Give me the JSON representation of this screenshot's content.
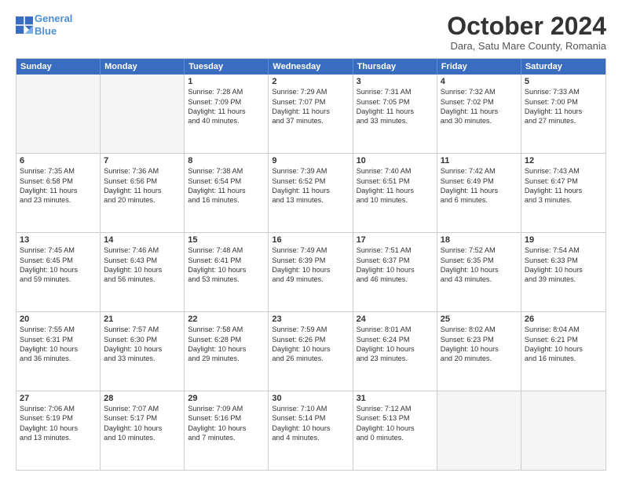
{
  "logo": {
    "line1": "General",
    "line2": "Blue"
  },
  "title": "October 2024",
  "subtitle": "Dara, Satu Mare County, Romania",
  "header_days": [
    "Sunday",
    "Monday",
    "Tuesday",
    "Wednesday",
    "Thursday",
    "Friday",
    "Saturday"
  ],
  "rows": [
    [
      {
        "day": "",
        "empty": true
      },
      {
        "day": "",
        "empty": true
      },
      {
        "day": "1",
        "lines": [
          "Sunrise: 7:28 AM",
          "Sunset: 7:09 PM",
          "Daylight: 11 hours",
          "and 40 minutes."
        ]
      },
      {
        "day": "2",
        "lines": [
          "Sunrise: 7:29 AM",
          "Sunset: 7:07 PM",
          "Daylight: 11 hours",
          "and 37 minutes."
        ]
      },
      {
        "day": "3",
        "lines": [
          "Sunrise: 7:31 AM",
          "Sunset: 7:05 PM",
          "Daylight: 11 hours",
          "and 33 minutes."
        ]
      },
      {
        "day": "4",
        "lines": [
          "Sunrise: 7:32 AM",
          "Sunset: 7:02 PM",
          "Daylight: 11 hours",
          "and 30 minutes."
        ]
      },
      {
        "day": "5",
        "lines": [
          "Sunrise: 7:33 AM",
          "Sunset: 7:00 PM",
          "Daylight: 11 hours",
          "and 27 minutes."
        ]
      }
    ],
    [
      {
        "day": "6",
        "lines": [
          "Sunrise: 7:35 AM",
          "Sunset: 6:58 PM",
          "Daylight: 11 hours",
          "and 23 minutes."
        ]
      },
      {
        "day": "7",
        "lines": [
          "Sunrise: 7:36 AM",
          "Sunset: 6:56 PM",
          "Daylight: 11 hours",
          "and 20 minutes."
        ]
      },
      {
        "day": "8",
        "lines": [
          "Sunrise: 7:38 AM",
          "Sunset: 6:54 PM",
          "Daylight: 11 hours",
          "and 16 minutes."
        ]
      },
      {
        "day": "9",
        "lines": [
          "Sunrise: 7:39 AM",
          "Sunset: 6:52 PM",
          "Daylight: 11 hours",
          "and 13 minutes."
        ]
      },
      {
        "day": "10",
        "lines": [
          "Sunrise: 7:40 AM",
          "Sunset: 6:51 PM",
          "Daylight: 11 hours",
          "and 10 minutes."
        ]
      },
      {
        "day": "11",
        "lines": [
          "Sunrise: 7:42 AM",
          "Sunset: 6:49 PM",
          "Daylight: 11 hours",
          "and 6 minutes."
        ]
      },
      {
        "day": "12",
        "lines": [
          "Sunrise: 7:43 AM",
          "Sunset: 6:47 PM",
          "Daylight: 11 hours",
          "and 3 minutes."
        ]
      }
    ],
    [
      {
        "day": "13",
        "lines": [
          "Sunrise: 7:45 AM",
          "Sunset: 6:45 PM",
          "Daylight: 10 hours",
          "and 59 minutes."
        ]
      },
      {
        "day": "14",
        "lines": [
          "Sunrise: 7:46 AM",
          "Sunset: 6:43 PM",
          "Daylight: 10 hours",
          "and 56 minutes."
        ]
      },
      {
        "day": "15",
        "lines": [
          "Sunrise: 7:48 AM",
          "Sunset: 6:41 PM",
          "Daylight: 10 hours",
          "and 53 minutes."
        ]
      },
      {
        "day": "16",
        "lines": [
          "Sunrise: 7:49 AM",
          "Sunset: 6:39 PM",
          "Daylight: 10 hours",
          "and 49 minutes."
        ]
      },
      {
        "day": "17",
        "lines": [
          "Sunrise: 7:51 AM",
          "Sunset: 6:37 PM",
          "Daylight: 10 hours",
          "and 46 minutes."
        ]
      },
      {
        "day": "18",
        "lines": [
          "Sunrise: 7:52 AM",
          "Sunset: 6:35 PM",
          "Daylight: 10 hours",
          "and 43 minutes."
        ]
      },
      {
        "day": "19",
        "lines": [
          "Sunrise: 7:54 AM",
          "Sunset: 6:33 PM",
          "Daylight: 10 hours",
          "and 39 minutes."
        ]
      }
    ],
    [
      {
        "day": "20",
        "lines": [
          "Sunrise: 7:55 AM",
          "Sunset: 6:31 PM",
          "Daylight: 10 hours",
          "and 36 minutes."
        ]
      },
      {
        "day": "21",
        "lines": [
          "Sunrise: 7:57 AM",
          "Sunset: 6:30 PM",
          "Daylight: 10 hours",
          "and 33 minutes."
        ]
      },
      {
        "day": "22",
        "lines": [
          "Sunrise: 7:58 AM",
          "Sunset: 6:28 PM",
          "Daylight: 10 hours",
          "and 29 minutes."
        ]
      },
      {
        "day": "23",
        "lines": [
          "Sunrise: 7:59 AM",
          "Sunset: 6:26 PM",
          "Daylight: 10 hours",
          "and 26 minutes."
        ]
      },
      {
        "day": "24",
        "lines": [
          "Sunrise: 8:01 AM",
          "Sunset: 6:24 PM",
          "Daylight: 10 hours",
          "and 23 minutes."
        ]
      },
      {
        "day": "25",
        "lines": [
          "Sunrise: 8:02 AM",
          "Sunset: 6:23 PM",
          "Daylight: 10 hours",
          "and 20 minutes."
        ]
      },
      {
        "day": "26",
        "lines": [
          "Sunrise: 8:04 AM",
          "Sunset: 6:21 PM",
          "Daylight: 10 hours",
          "and 16 minutes."
        ]
      }
    ],
    [
      {
        "day": "27",
        "lines": [
          "Sunrise: 7:06 AM",
          "Sunset: 5:19 PM",
          "Daylight: 10 hours",
          "and 13 minutes."
        ]
      },
      {
        "day": "28",
        "lines": [
          "Sunrise: 7:07 AM",
          "Sunset: 5:17 PM",
          "Daylight: 10 hours",
          "and 10 minutes."
        ]
      },
      {
        "day": "29",
        "lines": [
          "Sunrise: 7:09 AM",
          "Sunset: 5:16 PM",
          "Daylight: 10 hours",
          "and 7 minutes."
        ]
      },
      {
        "day": "30",
        "lines": [
          "Sunrise: 7:10 AM",
          "Sunset: 5:14 PM",
          "Daylight: 10 hours",
          "and 4 minutes."
        ]
      },
      {
        "day": "31",
        "lines": [
          "Sunrise: 7:12 AM",
          "Sunset: 5:13 PM",
          "Daylight: 10 hours",
          "and 0 minutes."
        ]
      },
      {
        "day": "",
        "empty": true
      },
      {
        "day": "",
        "empty": true
      }
    ]
  ]
}
